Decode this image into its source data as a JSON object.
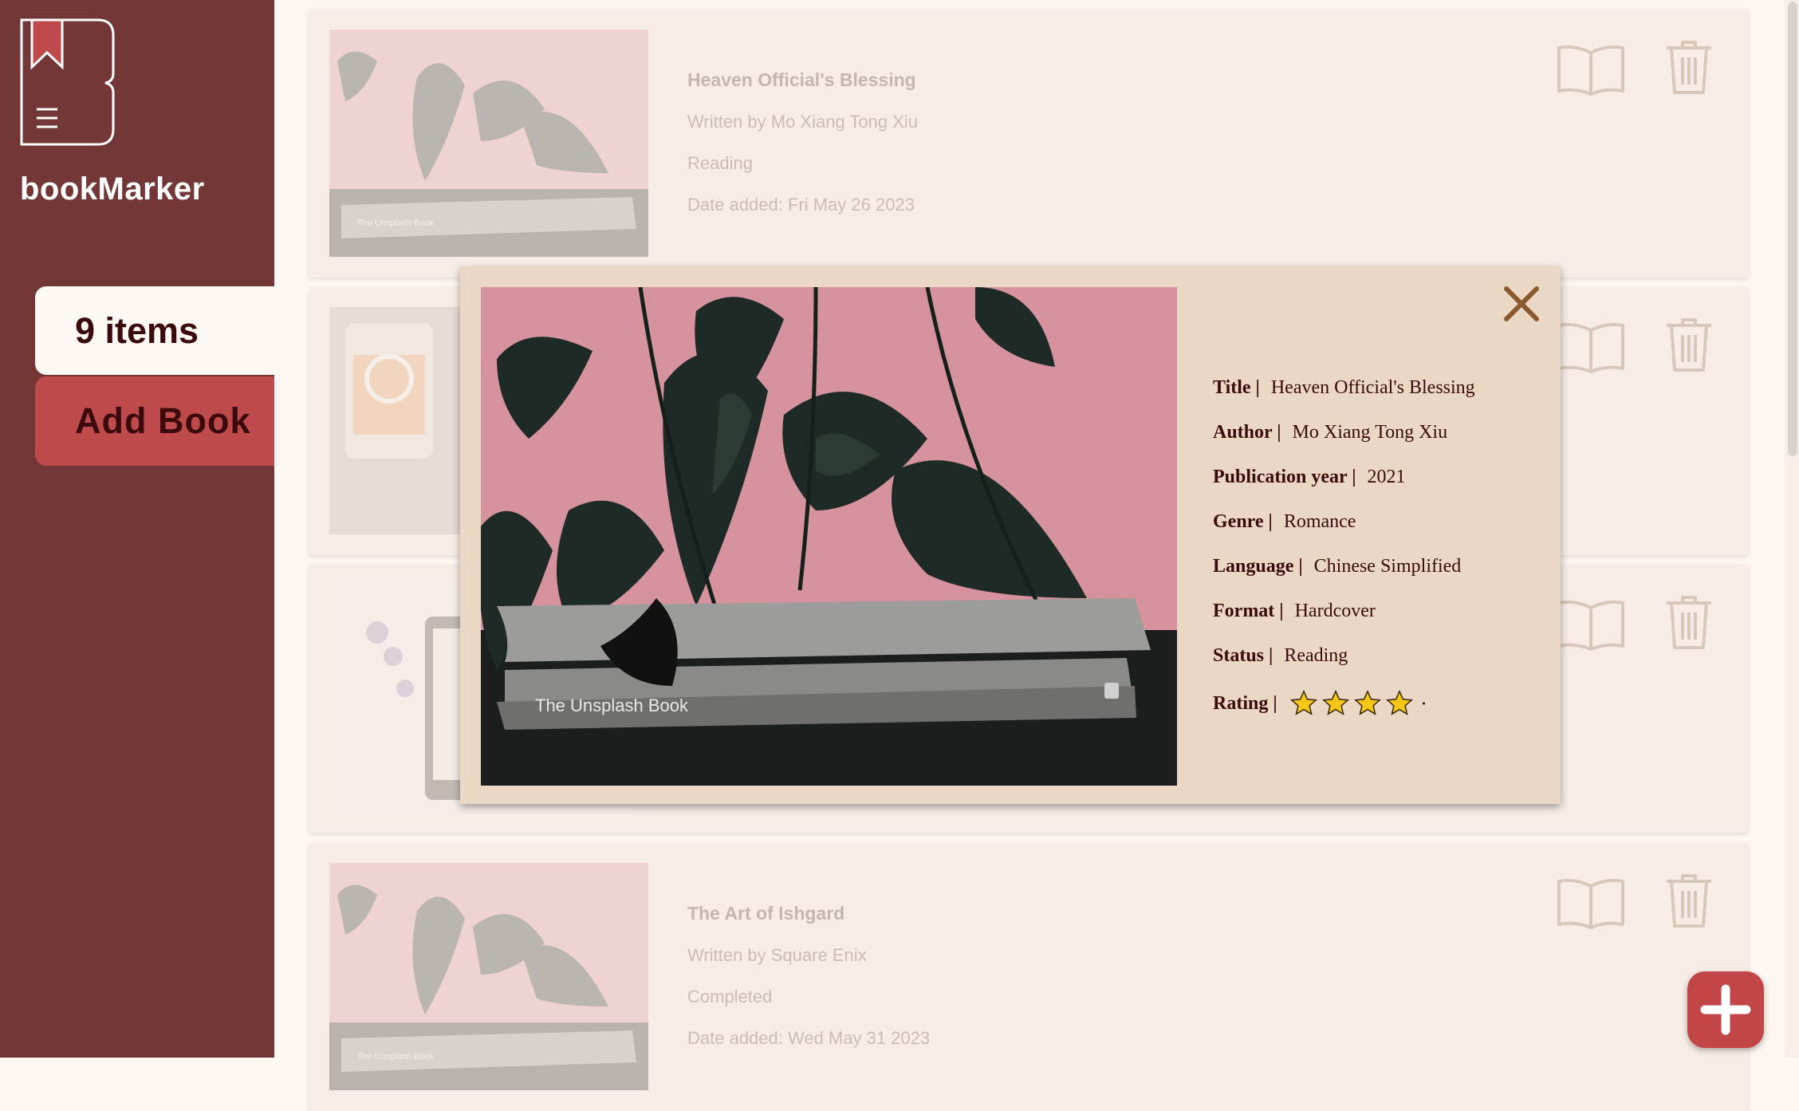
{
  "app": {
    "name": "bookMarker"
  },
  "sidebar": {
    "items_count": "9 items",
    "add_book_label": "Add Book"
  },
  "books": [
    {
      "title": "Heaven Official's Blessing",
      "author": "Written by Mo Xiang Tong Xiu",
      "status": "Reading",
      "date": "Date added: Fri May 26 2023",
      "cover": "plant-book"
    },
    {
      "title": "",
      "author": "",
      "status": "",
      "date": "",
      "cover": "headphones-phone"
    },
    {
      "title": "",
      "author": "",
      "status": "",
      "date": "",
      "cover": "ereader-flowers"
    },
    {
      "title": "The Art of Ishgard",
      "author": "Written by Square Enix",
      "status": "Completed",
      "date": "Date added: Wed May 31 2023",
      "cover": "plant-book"
    }
  ],
  "modal": {
    "cover_caption": "The Unsplash Book",
    "fields": [
      {
        "key": "Title |",
        "value": "Heaven Official's Blessing"
      },
      {
        "key": "Author |",
        "value": "Mo Xiang Tong Xiu"
      },
      {
        "key": "Publication year |",
        "value": "2021"
      },
      {
        "key": "Genre |",
        "value": "Romance"
      },
      {
        "key": "Language |",
        "value": "Chinese Simplified"
      },
      {
        "key": "Format |",
        "value": "Hardcover"
      },
      {
        "key": "Status |",
        "value": "Reading"
      }
    ],
    "rating_label": "Rating |",
    "rating": 4,
    "rating_max": 5
  },
  "colors": {
    "sidebar": "#733738",
    "accent": "#bf4a4c",
    "card": "#f8ede6",
    "modal": "#ead8c4",
    "text_dark": "#3a0a0d",
    "star": "#f5c518"
  },
  "icons": {
    "open": "open-book-icon",
    "delete": "trash-icon",
    "close": "close-icon",
    "add": "plus-icon",
    "menu": "hamburger-icon",
    "logo": "bookmark-logo-icon"
  }
}
